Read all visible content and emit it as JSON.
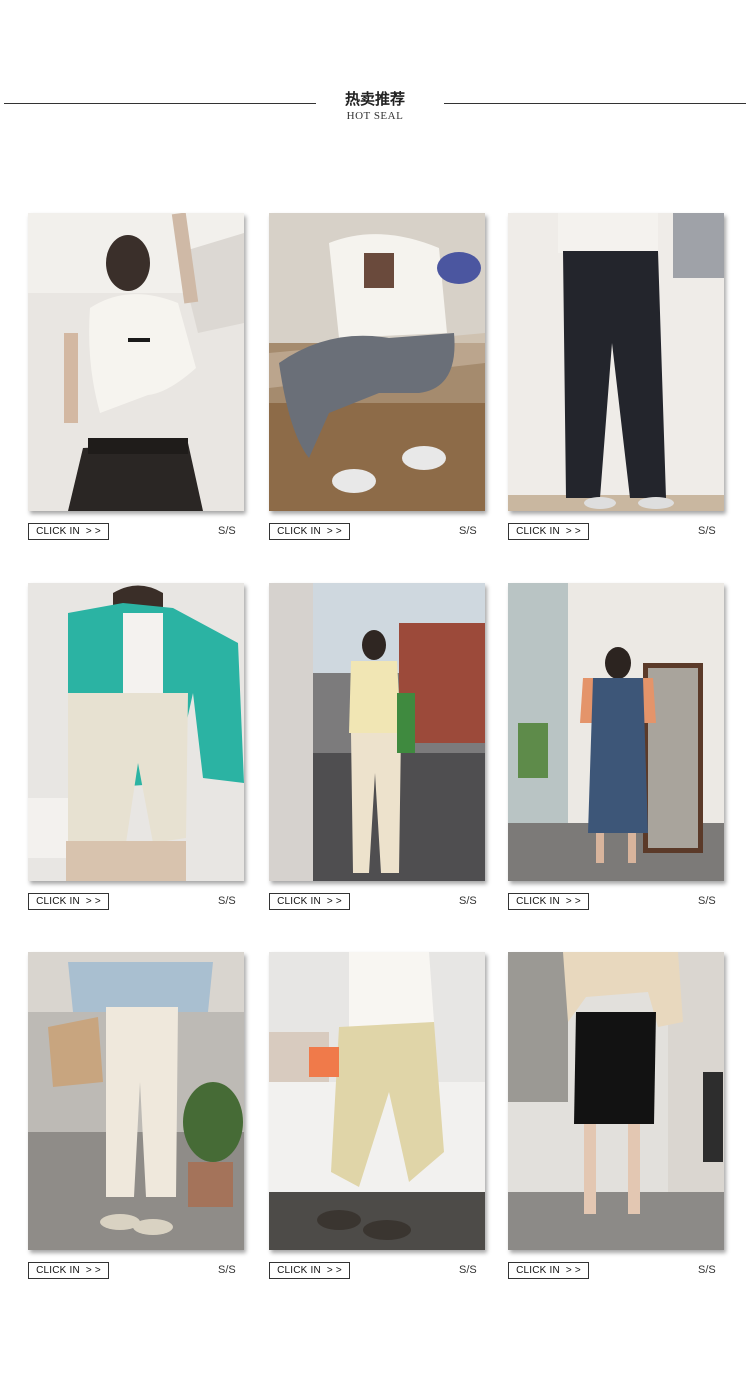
{
  "section": {
    "title_cn": "热卖推荐",
    "title_en": "HOT SEAL"
  },
  "products": [
    {
      "cta": "CLICK IN  > >",
      "size": "S/S",
      "image": "white-tee-black-skirt"
    },
    {
      "cta": "CLICK IN  > >",
      "size": "S/S",
      "image": "white-tee-grey-pants-seated"
    },
    {
      "cta": "CLICK IN  > >",
      "size": "S/S",
      "image": "black-wide-pants"
    },
    {
      "cta": "CLICK IN  > >",
      "size": "S/S",
      "image": "teal-shirt-beige-shorts"
    },
    {
      "cta": "CLICK IN  > >",
      "size": "S/S",
      "image": "yellow-tee-cream-pants-street"
    },
    {
      "cta": "CLICK IN  > >",
      "size": "S/S",
      "image": "denim-pinafore-dress-mirror"
    },
    {
      "cta": "CLICK IN  > >",
      "size": "S/S",
      "image": "blue-cardigan-cream-trousers"
    },
    {
      "cta": "CLICK IN  > >",
      "size": "S/S",
      "image": "white-tee-khaki-jogger"
    },
    {
      "cta": "CLICK IN  > >",
      "size": "S/S",
      "image": "beige-jacket-black-shorts"
    }
  ]
}
